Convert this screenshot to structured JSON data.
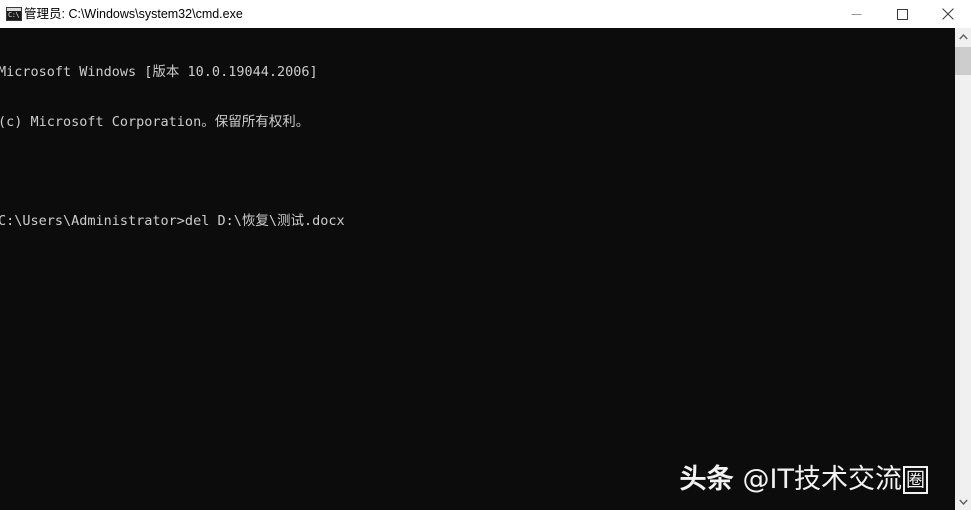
{
  "window": {
    "title": "管理员: C:\\Windows\\system32\\cmd.exe",
    "icon_name": "cmd-console-icon",
    "icon_glyph": "C:\\",
    "titlebar_bg": "#ffffff",
    "console_bg": "#0c0c0c",
    "console_fg": "#cccccc"
  },
  "controls": {
    "minimize_label": "最小化",
    "maximize_label": "最大化",
    "close_label": "关闭"
  },
  "console": {
    "lines": [
      "Microsoft Windows [版本 10.0.19044.2006]",
      "(c) Microsoft Corporation。保留所有权利。",
      "",
      "C:\\Users\\Administrator>del D:\\恢复\\测试.docx"
    ],
    "prompt": "C:\\Users\\Administrator>",
    "command": "del D:\\恢复\\测试.docx",
    "os_version": "10.0.19044.2006"
  },
  "watermark": {
    "brand": "头条",
    "at": "@",
    "handle": "IT技术交流",
    "boxed_char": "圈"
  },
  "scrollbar": {
    "up_arrow": "scroll-up-arrow",
    "down_arrow": "scroll-down-arrow",
    "thumb": "scroll-thumb",
    "track_color": "#f0f0f0",
    "thumb_color": "#cdcdcd"
  }
}
